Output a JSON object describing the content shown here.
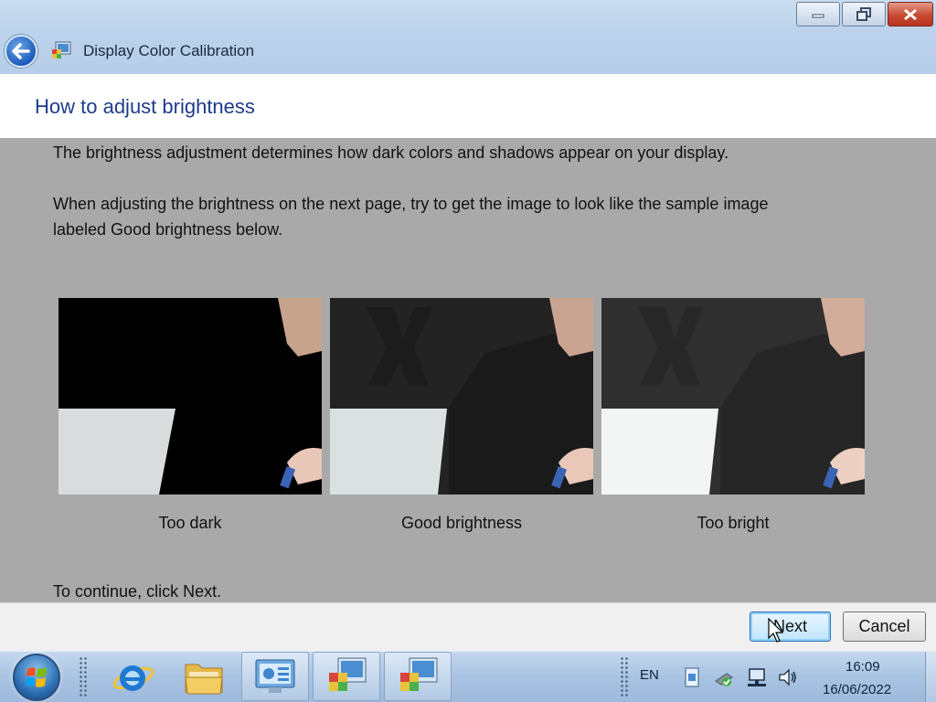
{
  "window": {
    "title": "Display Color Calibration",
    "controls": {
      "minimize": "minimize",
      "restore": "restore",
      "close": "close"
    }
  },
  "page": {
    "heading": "How to adjust brightness",
    "paragraph1": "The brightness adjustment determines how dark colors and shadows appear on your display.",
    "paragraph2_line1": "When adjusting the brightness on the next page, try to get the image to look like the sample image",
    "paragraph2_line2": "labeled Good brightness below.",
    "continue_text": "To continue, click Next."
  },
  "samples": [
    {
      "caption": "Too dark"
    },
    {
      "caption": "Good brightness"
    },
    {
      "caption": "Too bright"
    }
  ],
  "buttons": {
    "next": "Next",
    "cancel": "Cancel"
  },
  "taskbar": {
    "pinned": [
      "start-orb",
      "internet-explorer-icon",
      "windows-explorer-icon",
      "control-panel-icon",
      "color-calibration-icon",
      "color-calibration-icon"
    ],
    "language": "EN",
    "time": "16:09",
    "date": "16/06/2022"
  },
  "colors": {
    "heading": "#1f3b8a",
    "content_bg": "#a9a9a9",
    "titlebar": "#bdd3ec"
  }
}
